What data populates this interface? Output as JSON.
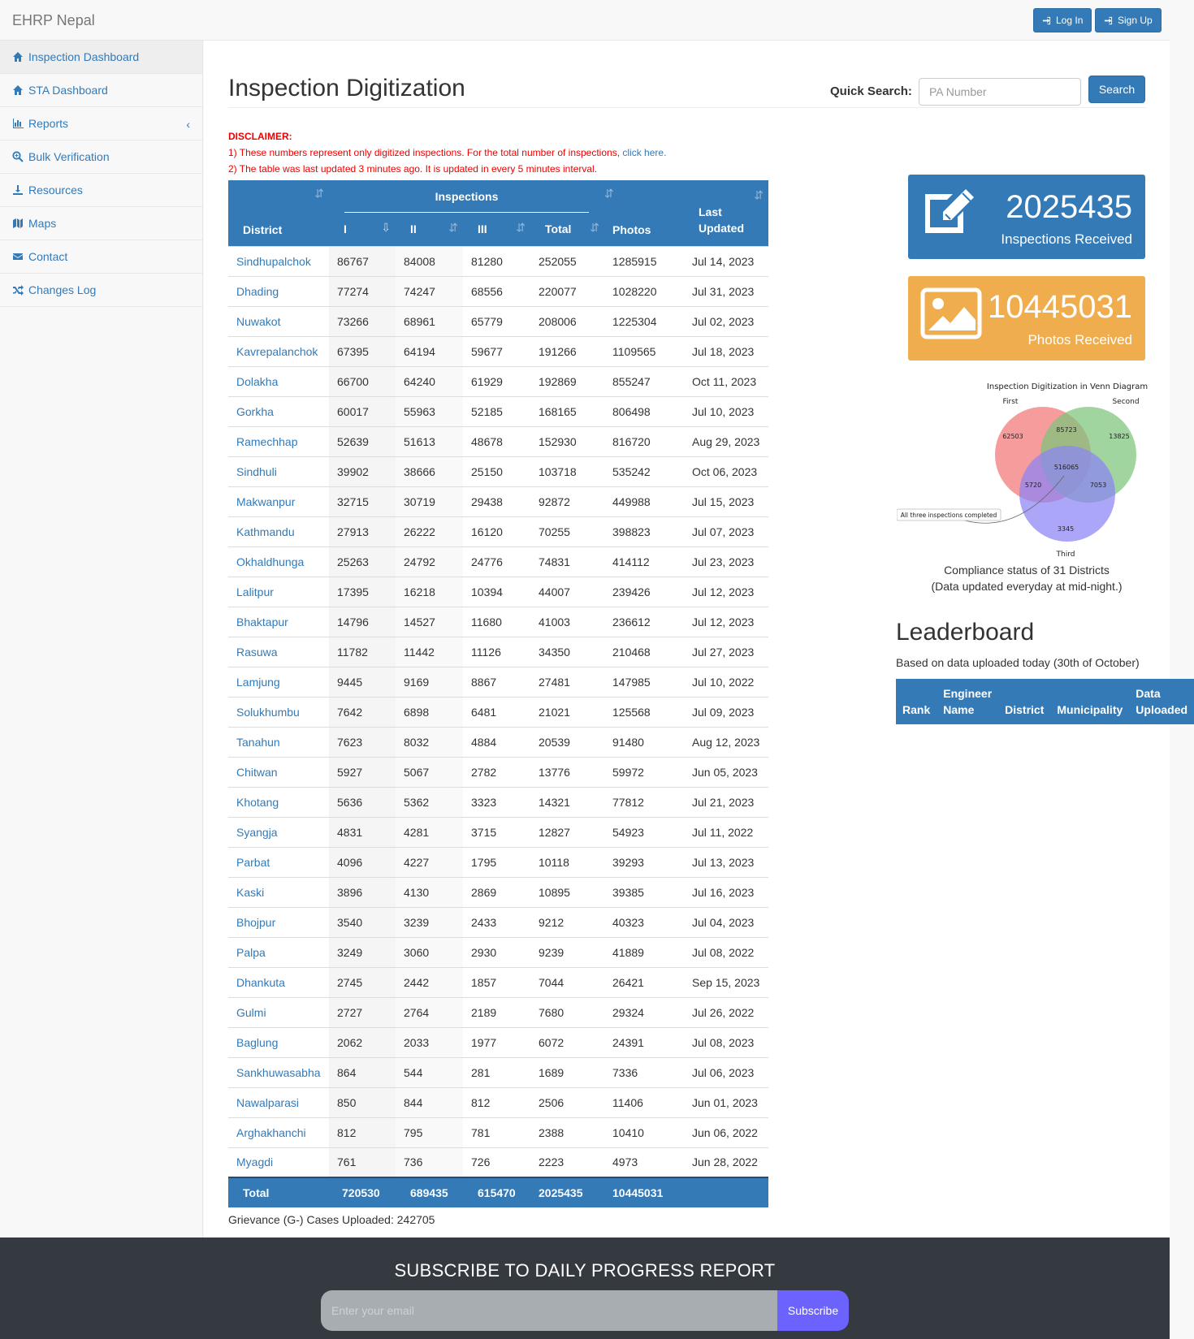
{
  "brand": "EHRP Nepal",
  "topbar": {
    "login_label": "Log In",
    "signup_label": "Sign Up"
  },
  "sidebar": {
    "items": [
      {
        "label": "Inspection Dashboard",
        "icon": "home-icon"
      },
      {
        "label": "STA Dashboard",
        "icon": "home-icon"
      },
      {
        "label": "Reports",
        "icon": "bar-chart-icon"
      },
      {
        "label": "Bulk Verification",
        "icon": "search-plus-icon"
      },
      {
        "label": "Resources",
        "icon": "download-icon"
      },
      {
        "label": "Maps",
        "icon": "map-icon"
      },
      {
        "label": "Contact",
        "icon": "envelope-icon"
      },
      {
        "label": "Changes Log",
        "icon": "shuffle-icon"
      }
    ]
  },
  "page": {
    "title": "Inspection Digitization",
    "quick_search_label": "Quick Search:",
    "search_placeholder": "PA Number",
    "search_button": "Search"
  },
  "disclaimer": {
    "head": "DISCLAIMER:",
    "line1": "1) These numbers represent only digitized inspections. For the total number of inspections,",
    "line1_link": "click here.",
    "line2": "2) The table was last updated 3 minutes ago. It is updated in every 5 minutes interval."
  },
  "table": {
    "headers": {
      "district": "District",
      "inspections": "Inspections",
      "i": "I",
      "ii": "II",
      "iii": "III",
      "total": "Total",
      "photos": "Photos",
      "last_updated": "Last Updated"
    },
    "rows": [
      [
        "Sindhupalchok",
        "86767",
        "84008",
        "81280",
        "252055",
        "1285915",
        "Jul 14, 2023"
      ],
      [
        "Dhading",
        "77274",
        "74247",
        "68556",
        "220077",
        "1028220",
        "Jul 31, 2023"
      ],
      [
        "Nuwakot",
        "73266",
        "68961",
        "65779",
        "208006",
        "1225304",
        "Jul 02, 2023"
      ],
      [
        "Kavrepalanchok",
        "67395",
        "64194",
        "59677",
        "191266",
        "1109565",
        "Jul 18, 2023"
      ],
      [
        "Dolakha",
        "66700",
        "64240",
        "61929",
        "192869",
        "855247",
        "Oct 11, 2023"
      ],
      [
        "Gorkha",
        "60017",
        "55963",
        "52185",
        "168165",
        "806498",
        "Jul 10, 2023"
      ],
      [
        "Ramechhap",
        "52639",
        "51613",
        "48678",
        "152930",
        "816720",
        "Aug 29, 2023"
      ],
      [
        "Sindhuli",
        "39902",
        "38666",
        "25150",
        "103718",
        "535242",
        "Oct 06, 2023"
      ],
      [
        "Makwanpur",
        "32715",
        "30719",
        "29438",
        "92872",
        "449988",
        "Jul 15, 2023"
      ],
      [
        "Kathmandu",
        "27913",
        "26222",
        "16120",
        "70255",
        "398823",
        "Jul 07, 2023"
      ],
      [
        "Okhaldhunga",
        "25263",
        "24792",
        "24776",
        "74831",
        "414112",
        "Jul 23, 2023"
      ],
      [
        "Lalitpur",
        "17395",
        "16218",
        "10394",
        "44007",
        "239426",
        "Jul 12, 2023"
      ],
      [
        "Bhaktapur",
        "14796",
        "14527",
        "11680",
        "41003",
        "236612",
        "Jul 12, 2023"
      ],
      [
        "Rasuwa",
        "11782",
        "11442",
        "11126",
        "34350",
        "210468",
        "Jul 27, 2023"
      ],
      [
        "Lamjung",
        "9445",
        "9169",
        "8867",
        "27481",
        "147985",
        "Jul 10, 2022"
      ],
      [
        "Solukhumbu",
        "7642",
        "6898",
        "6481",
        "21021",
        "125568",
        "Jul 09, 2023"
      ],
      [
        "Tanahun",
        "7623",
        "8032",
        "4884",
        "20539",
        "91480",
        "Aug 12, 2023"
      ],
      [
        "Chitwan",
        "5927",
        "5067",
        "2782",
        "13776",
        "59972",
        "Jun 05, 2023"
      ],
      [
        "Khotang",
        "5636",
        "5362",
        "3323",
        "14321",
        "77812",
        "Jul 21, 2023"
      ],
      [
        "Syangja",
        "4831",
        "4281",
        "3715",
        "12827",
        "54923",
        "Jul 11, 2022"
      ],
      [
        "Parbat",
        "4096",
        "4227",
        "1795",
        "10118",
        "39293",
        "Jul 13, 2023"
      ],
      [
        "Kaski",
        "3896",
        "4130",
        "2869",
        "10895",
        "39385",
        "Jul 16, 2023"
      ],
      [
        "Bhojpur",
        "3540",
        "3239",
        "2433",
        "9212",
        "40323",
        "Jul 04, 2023"
      ],
      [
        "Palpa",
        "3249",
        "3060",
        "2930",
        "9239",
        "41889",
        "Jul 08, 2022"
      ],
      [
        "Dhankuta",
        "2745",
        "2442",
        "1857",
        "7044",
        "26421",
        "Sep 15, 2023"
      ],
      [
        "Gulmi",
        "2727",
        "2764",
        "2189",
        "7680",
        "29324",
        "Jul 26, 2022"
      ],
      [
        "Baglung",
        "2062",
        "2033",
        "1977",
        "6072",
        "24391",
        "Jul 08, 2023"
      ],
      [
        "Sankhuwasabha",
        "864",
        "544",
        "281",
        "1689",
        "7336",
        "Jul 06, 2023"
      ],
      [
        "Nawalparasi",
        "850",
        "844",
        "812",
        "2506",
        "11406",
        "Jun 01, 2023"
      ],
      [
        "Arghakhanchi",
        "812",
        "795",
        "781",
        "2388",
        "10410",
        "Jun 06, 2022"
      ],
      [
        "Myagdi",
        "761",
        "736",
        "726",
        "2223",
        "4973",
        "Jun 28, 2022"
      ]
    ],
    "totals": [
      "Total",
      "720530",
      "689435",
      "615470",
      "2025435",
      "10445031",
      ""
    ]
  },
  "grievance": "Grievance (G-) Cases Uploaded: 242705",
  "stats": {
    "inspections": {
      "value": "2025435",
      "label": "Inspections Received",
      "color": "#337ab7",
      "icon": "edit-icon"
    },
    "photos": {
      "value": "10445031",
      "label": "Photos Received",
      "color": "#f0ad4e",
      "icon": "image-icon"
    }
  },
  "venn": {
    "title": "Inspection Digitization in Venn Diagram",
    "set_first": "First",
    "set_second": "Second",
    "set_third": "Third",
    "only_first": "62503",
    "only_second": "13825",
    "only_third": "3345",
    "first_second": "85723",
    "first_third": "5720",
    "second_third": "7053",
    "all_three": "516065",
    "annotation": "All three inspections completed"
  },
  "compliance": {
    "line1": "Compliance status of 31 Districts",
    "line2": "(Data updated everyday at mid-night.)"
  },
  "leaderboard": {
    "title": "Leaderboard",
    "subtitle": "Based on data uploaded today (30th of October)",
    "headers": [
      "Rank",
      "Engineer Name",
      "District",
      "Municipality",
      "Data Uploaded"
    ]
  },
  "footer": {
    "title": "SUBSCRIBE TO DAILY PROGRESS REPORT",
    "email_placeholder": "Enter your email",
    "subscribe_label": "Subscribe"
  }
}
